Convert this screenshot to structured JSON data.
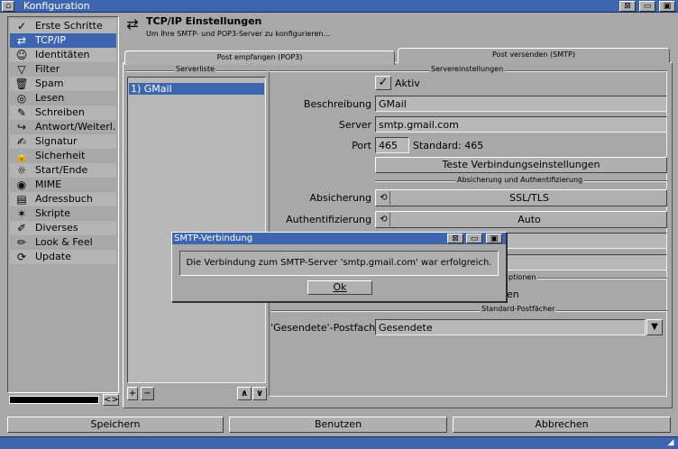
{
  "window": {
    "title": "Konfiguration",
    "buttons": [
      "⊠",
      "▭",
      "▣"
    ]
  },
  "sidebar": {
    "items": [
      {
        "label": "Erste Schritte",
        "icon": "✓"
      },
      {
        "label": "TCP/IP",
        "icon": "⇄"
      },
      {
        "label": "Identitäten",
        "icon": "☺"
      },
      {
        "label": "Filter",
        "icon": "▽"
      },
      {
        "label": "Spam",
        "icon": "🗑"
      },
      {
        "label": "Lesen",
        "icon": "◎"
      },
      {
        "label": "Schreiben",
        "icon": "✎"
      },
      {
        "label": "Antwort/Weiterl.",
        "icon": "↪"
      },
      {
        "label": "Signatur",
        "icon": "✍"
      },
      {
        "label": "Sicherheit",
        "icon": "🔒"
      },
      {
        "label": "Start/Ende",
        "icon": "☼"
      },
      {
        "label": "MIME",
        "icon": "◉"
      },
      {
        "label": "Adressbuch",
        "icon": "▤"
      },
      {
        "label": "Skripte",
        "icon": "✶"
      },
      {
        "label": "Diverses",
        "icon": "✐"
      },
      {
        "label": "Look & Feel",
        "icon": "✏"
      },
      {
        "label": "Update",
        "icon": "⟳"
      }
    ],
    "scroll_arrows": "<>"
  },
  "header": {
    "title": "TCP/IP Einstellungen",
    "subtitle": "Um Ihre SMTP- und POP3-Server zu konfigurieren..."
  },
  "tabs": [
    {
      "label": "Post empfangen (POP3)"
    },
    {
      "label": "Post versenden (SMTP)"
    }
  ],
  "serverlist": {
    "title": "Serverliste",
    "items": [
      "1) GMail"
    ],
    "add": "+",
    "remove": "−",
    "up": "∧",
    "down": "∨"
  },
  "settings": {
    "group": "Servereinstellungen",
    "aktiv_label": "Aktiv",
    "aktiv_checked": "✓",
    "beschreibung_label": "Beschreibung",
    "beschreibung_value": "GMail",
    "server_label": "Server",
    "server_value": "smtp.gmail.com",
    "port_label": "Port",
    "port_value": "465",
    "port_standard": "Standard: 465",
    "test_button": "Teste Verbindungseinstellungen",
    "security_group": "Absicherung und Authentifizierung",
    "absicherung_label": "Absicherung",
    "absicherung_value": "SSL/TLS",
    "auth_label": "Authentifizierung",
    "auth_value": "Auto",
    "options_partial": "ptionen",
    "partial_text": "en",
    "mailbox_group": "Standard-Postfächer",
    "gesendete_label": "'Gesendete'-Postfach",
    "gesendete_value": "Gesendete",
    "popup_icon": "▼"
  },
  "dialog": {
    "title": "SMTP-Verbindung",
    "message": "Die Verbindung zum SMTP-Server 'smtp.gmail.com' war erfolgreich.",
    "ok": "Ok"
  },
  "bottom": {
    "save": "Speichern",
    "use": "Benutzen",
    "cancel": "Abbrechen"
  },
  "colors": {
    "accent": "#3e66b0",
    "background": "#a8a8a8"
  }
}
